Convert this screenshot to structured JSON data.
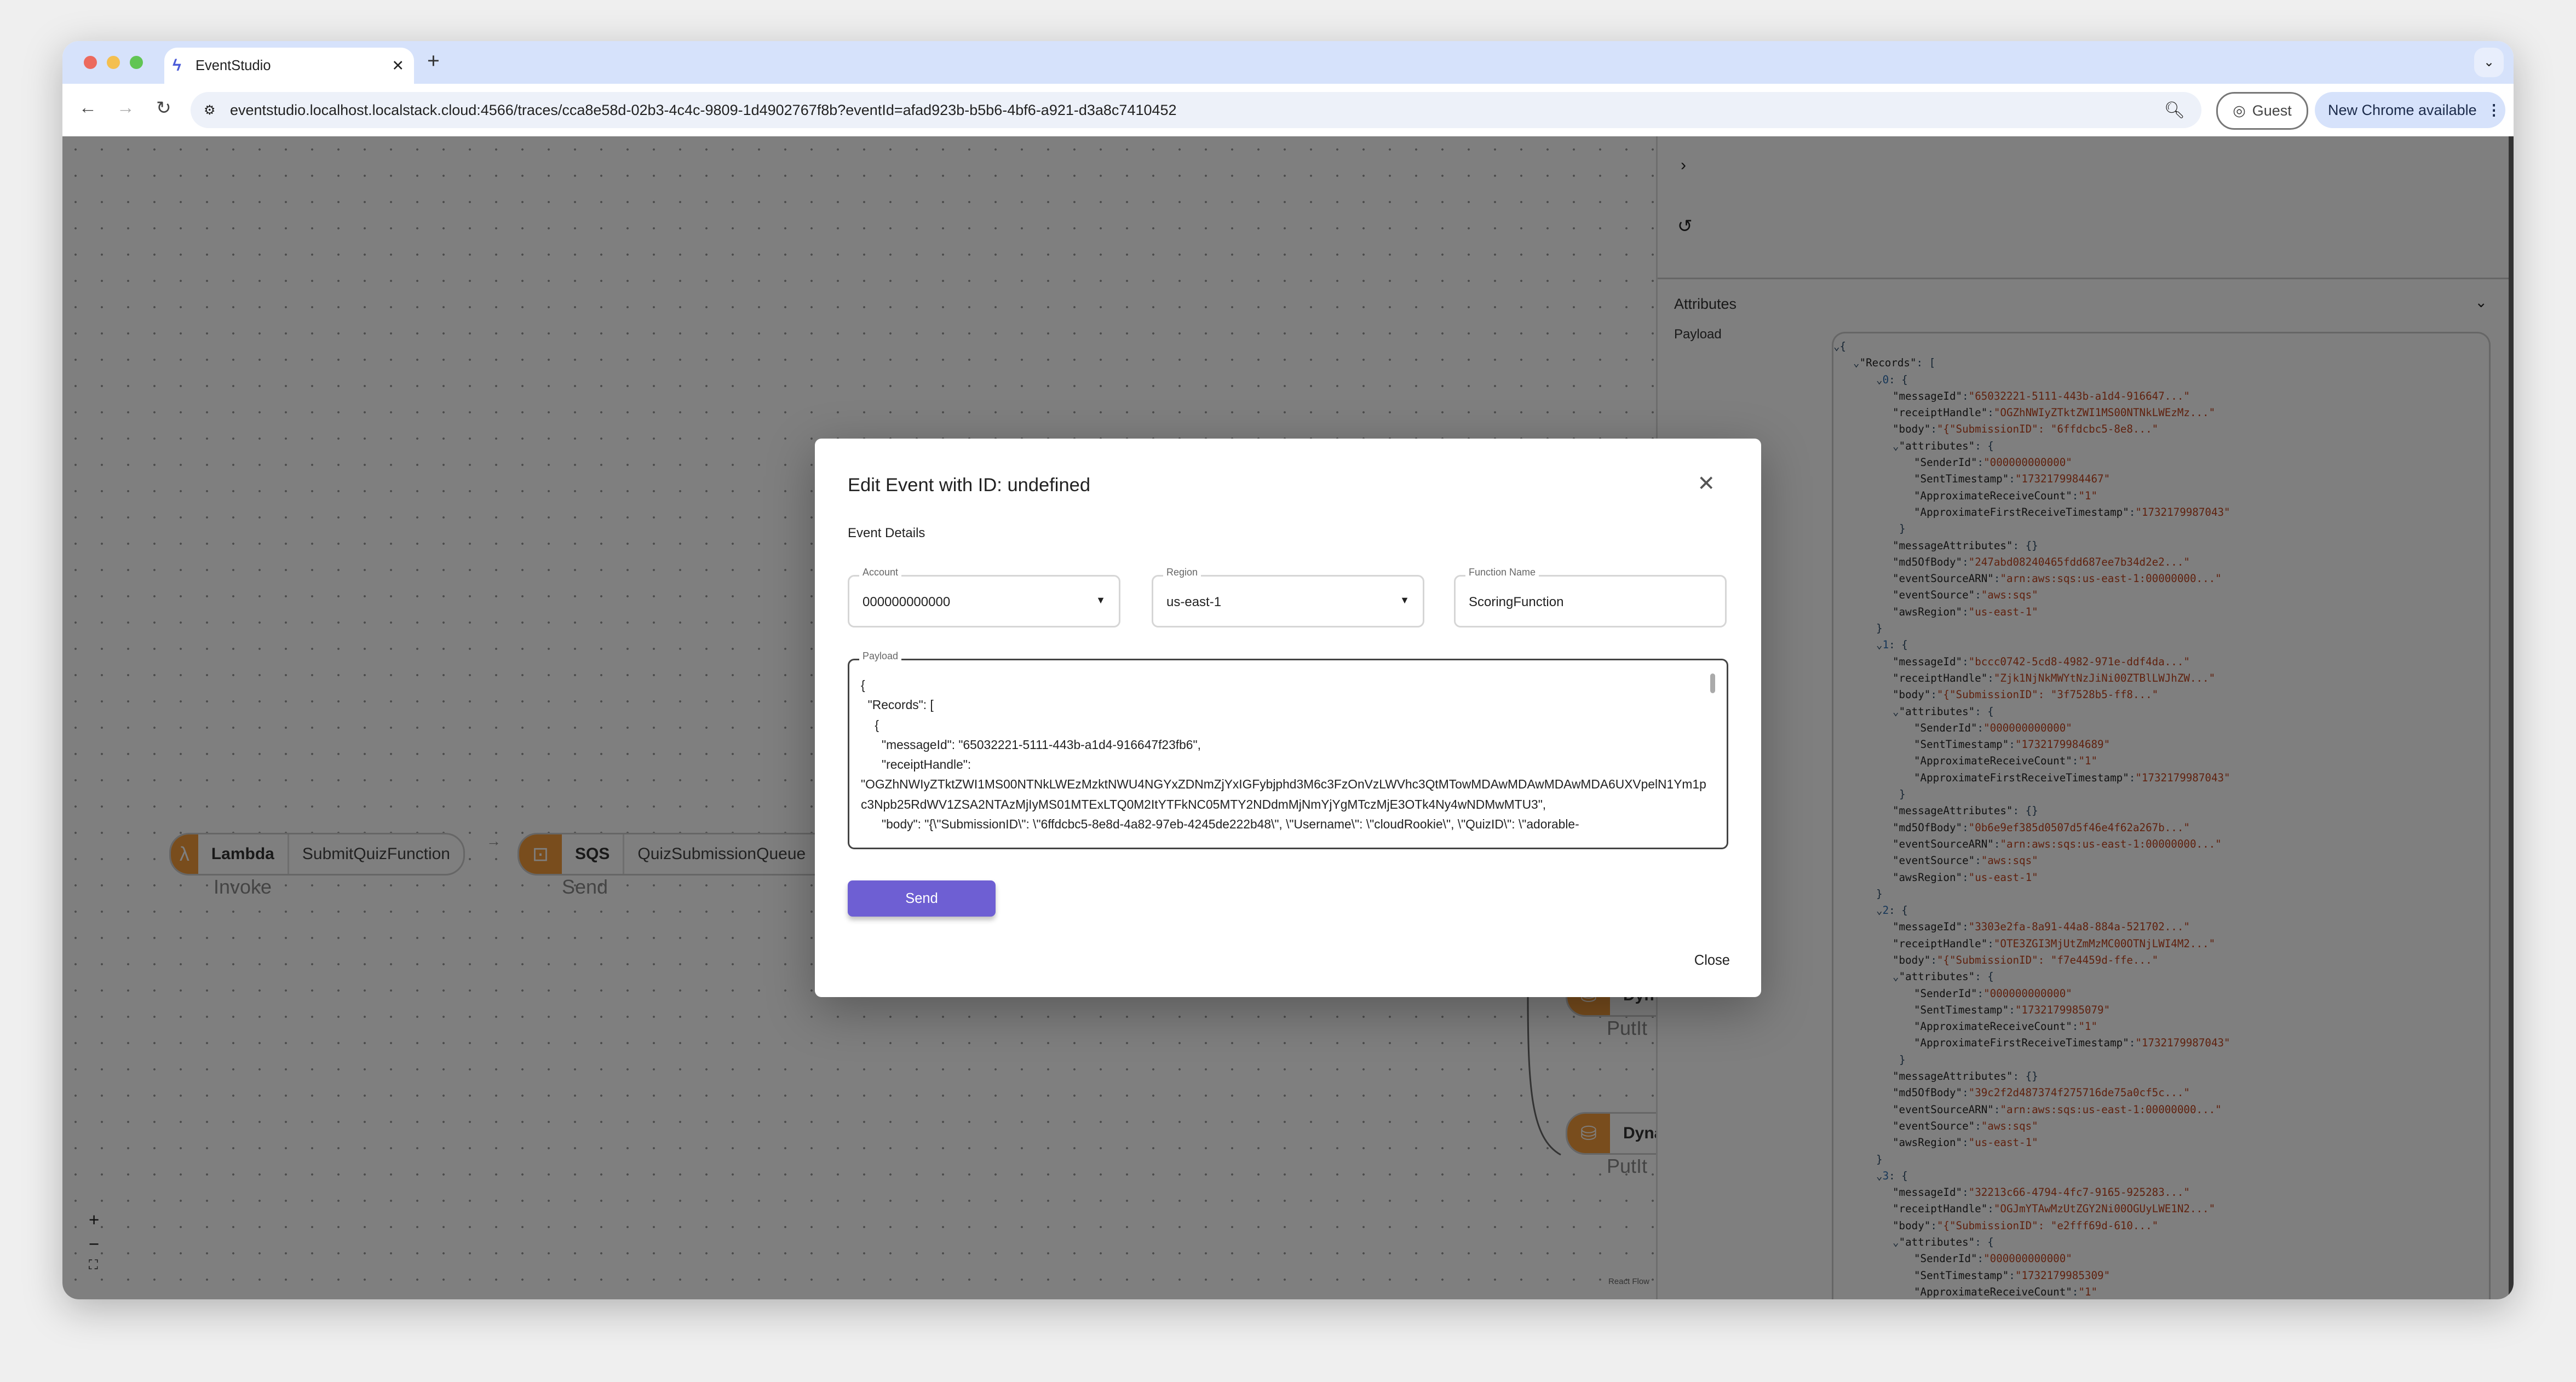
{
  "browser": {
    "tab_title": "EventStudio",
    "url": "eventstudio.localhost.localstack.cloud:4566/traces/cca8e58d-02b3-4c4c-9809-1d4902767f8b?eventId=afad923b-b5b6-4bf6-a921-d3a8c7410452",
    "profile_label": "Guest",
    "update_label": "New Chrome available"
  },
  "flow": {
    "nodes": [
      {
        "service": "Lambda",
        "resource": "SubmitQuizFunction",
        "operation": "Invoke",
        "icon": "lambda-icon"
      },
      {
        "service": "SQS",
        "resource": "QuizSubmissionQueue",
        "operation": "Send",
        "icon": "sqs-icon"
      },
      {
        "service": "Dyn",
        "resource": "",
        "operation": "PutIt",
        "icon": "dynamodb-icon"
      },
      {
        "service": "Dyna",
        "resource": "",
        "operation": "PutIt",
        "icon": "dynamodb-icon"
      }
    ],
    "attribution": "React Flow",
    "zoom_in": "+",
    "zoom_out": "−",
    "fit": "⛶"
  },
  "panel": {
    "attributes_label": "Attributes",
    "payload_label": "Payload",
    "records": [
      {
        "messageId": "65032221-5111-443b-a1d4-916647...",
        "receiptHandle": "OGZhNWIyZTktZWI1MS00NTNkLWEzMz...",
        "body": "{\"SubmissionID\": \"6ffdcbc5-8e8...",
        "attributes": {
          "SenderId": "000000000000",
          "SentTimestamp": "1732179984467",
          "ApproximateReceiveCount": "1",
          "ApproximateFirstReceiveTimestamp": "1732179987043"
        },
        "messageAttributes": "{}",
        "md5OfBody": "247abd08240465fdd687ee7b34d2e2...",
        "eventSourceARN": "arn:aws:sqs:us-east-1:00000000...",
        "eventSource": "aws:sqs",
        "awsRegion": "us-east-1"
      },
      {
        "messageId": "bccc0742-5cd8-4982-971e-ddf4da...",
        "receiptHandle": "Zjk1NjNkMWYtNzJiNi00ZTBlLWJhZW...",
        "body": "{\"SubmissionID\": \"3f7528b5-ff8...",
        "attributes": {
          "SenderId": "000000000000",
          "SentTimestamp": "1732179984689",
          "ApproximateReceiveCount": "1",
          "ApproximateFirstReceiveTimestamp": "1732179987043"
        },
        "messageAttributes": "{}",
        "md5OfBody": "0b6e9ef385d0507d5f46e4f62a267b...",
        "eventSourceARN": "arn:aws:sqs:us-east-1:00000000...",
        "eventSource": "aws:sqs",
        "awsRegion": "us-east-1"
      },
      {
        "messageId": "3303e2fa-8a91-44a8-884a-521702...",
        "receiptHandle": "OTE3ZGI3MjUtZmMzMC00OTNjLWI4M2...",
        "body": "{\"SubmissionID\": \"f7e4459d-ffe...",
        "attributes": {
          "SenderId": "000000000000",
          "SentTimestamp": "1732179985079",
          "ApproximateReceiveCount": "1",
          "ApproximateFirstReceiveTimestamp": "1732179987043"
        },
        "messageAttributes": "{}",
        "md5OfBody": "39c2f2d487374f275716de75a0cf5c...",
        "eventSourceARN": "arn:aws:sqs:us-east-1:00000000...",
        "eventSource": "aws:sqs",
        "awsRegion": "us-east-1"
      },
      {
        "messageId": "32213c66-4794-4fc7-9165-925283...",
        "receiptHandle": "OGJmYTAwMzUtZGY2Ni00OGUyLWE1N2...",
        "body": "{\"SubmissionID\": \"e2fff69d-610...",
        "attributes": {
          "SenderId": "000000000000",
          "SentTimestamp": "1732179985309",
          "ApproximateReceiveCount": "1"
        }
      }
    ]
  },
  "modal": {
    "title": "Edit Event with ID: undefined",
    "section": "Event Details",
    "account_label": "Account",
    "account_value": "000000000000",
    "region_label": "Region",
    "region_value": "us-east-1",
    "function_label": "Function Name",
    "function_value": "ScoringFunction",
    "payload_label": "Payload",
    "payload_text": "{\n  \"Records\": [\n    {\n      \"messageId\": \"65032221-5111-443b-a1d4-916647f23fb6\",\n      \"receiptHandle\":\n\"OGZhNWIyZTktZWI1MS00NTNkLWEzMzktNWU4NGYxZDNmZjYxIGFybjphd3M6c3FzOnVzLWVhc3QtMTowMDAwMDAwMDAwMDA6UXVpelN1Ym1pc3Npb25RdWV1ZSA2NTAzMjIyMS01MTExLTQ0M2ItYTFkNC05MTY2NDdmMjNmYjYgMTczMjE3OTk4Ny4wNDMwMTU3\",\n      \"body\": \"{\\\"SubmissionID\\\": \\\"6ffdcbc5-8e8d-4a82-97eb-4245de222b48\\\", \\\"Username\\\": \\\"cloudRookie\\\", \\\"QuizID\\\": \\\"adorable-",
    "send_label": "Send",
    "close_label": "Close"
  }
}
